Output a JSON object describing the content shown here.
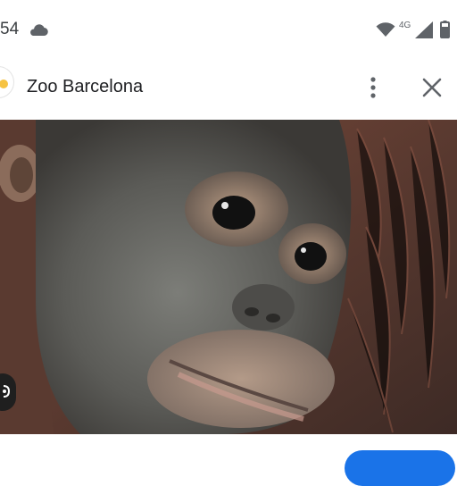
{
  "status_bar": {
    "time": "54",
    "network_type": "4G",
    "icons": [
      "cloud-icon",
      "wifi-icon",
      "signal-icon",
      "battery-icon"
    ]
  },
  "header": {
    "title": "Zoo Barcelona",
    "icons": [
      "site-avatar-icon",
      "more-vert-icon",
      "close-icon"
    ]
  },
  "image": {
    "subject": "young orangutan face close-up"
  },
  "colors": {
    "accent_blue": "#1a73e8",
    "text_primary": "#202124",
    "icon_gray": "#5f6368"
  }
}
